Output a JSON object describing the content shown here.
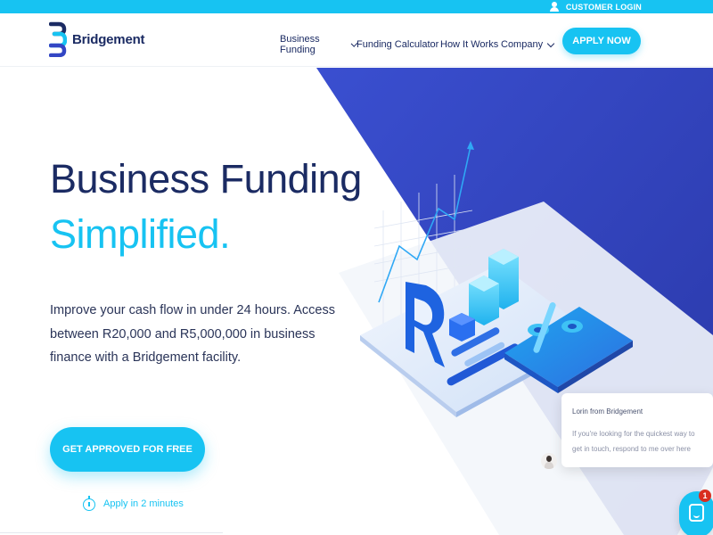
{
  "topbar": {
    "login_label": "CUSTOMER LOGIN",
    "login_icon": "user-icon"
  },
  "header": {
    "logo_text": "Bridgement",
    "nav": [
      {
        "label": "Business Funding",
        "has_dropdown": true
      },
      {
        "label": "Funding Calculator",
        "has_dropdown": false
      },
      {
        "label": "How It Works",
        "has_dropdown": false
      },
      {
        "label": "Company",
        "has_dropdown": true
      }
    ],
    "apply_label": "APPLY NOW"
  },
  "hero": {
    "headline_line1": "Business Funding",
    "headline_line2": "Simplified.",
    "subtext": "Improve your cash flow in under 24 hours. Access between R20,000 and R5,000,000 in business finance with a Bridgement facility.",
    "cta_label": "GET APPROVED FOR FREE",
    "apply_time_label": "Apply in 2 minutes"
  },
  "chat": {
    "from_label": "Lorin from Bridgement",
    "message": "If you're looking for the quickest way to get in touch, respond to me over here",
    "badge_count": "1"
  },
  "colors": {
    "brand_cyan": "#17c3f2",
    "brand_navy": "#1b2b63",
    "hero_blue": "#3346c4"
  }
}
